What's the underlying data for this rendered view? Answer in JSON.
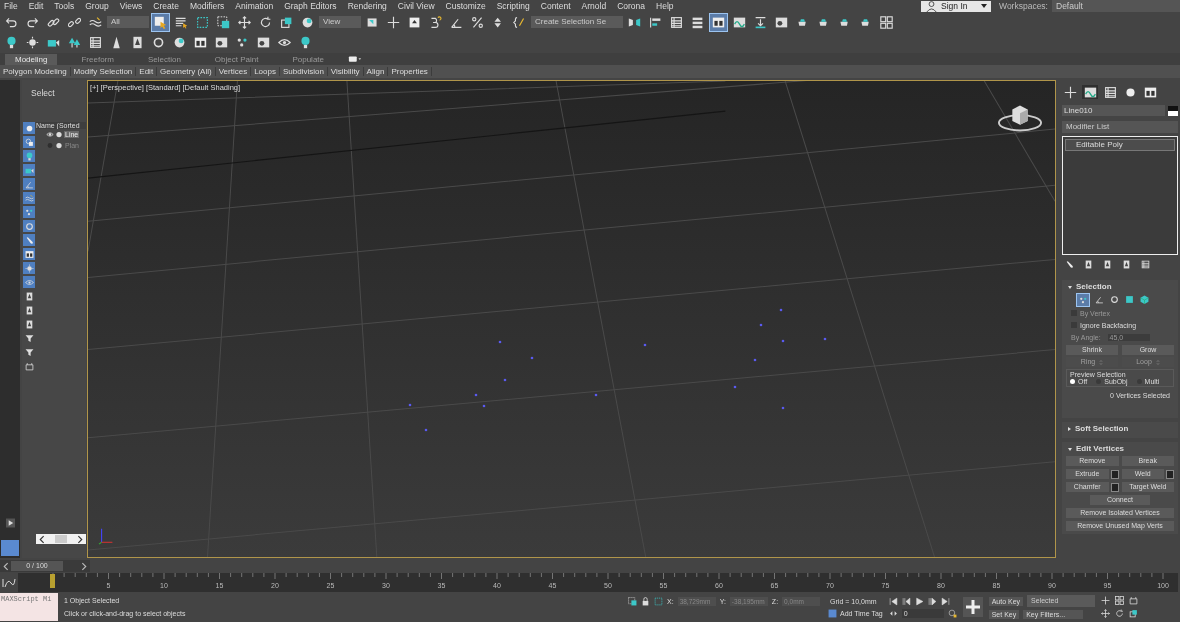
{
  "menu_bar": {
    "items": [
      "File",
      "Edit",
      "Tools",
      "Group",
      "Views",
      "Create",
      "Modifiers",
      "Animation",
      "Graph Editors",
      "Rendering",
      "Civil View",
      "Customize",
      "Scripting",
      "Content",
      "Arnold",
      "Corona",
      "Help"
    ],
    "sign_in": "Sign In",
    "workspaces_label": "Workspaces:",
    "workspace": "Default"
  },
  "main_toolbar": [
    {
      "kind": "tool",
      "selected": false
    },
    {
      "kind": "tool",
      "selected": false
    },
    {
      "kind": "tool",
      "selected": false
    },
    {
      "kind": "tool",
      "selected": false
    },
    {
      "kind": "tool",
      "selected": false
    },
    {
      "kind": "dropdown",
      "value": "All"
    },
    {
      "kind": "tool",
      "selected": true
    },
    {
      "kind": "tool",
      "selected": false
    },
    {
      "kind": "tool",
      "selected": false
    },
    {
      "kind": "tool",
      "selected": false
    },
    {
      "kind": "tool",
      "selected": false
    },
    {
      "kind": "tool",
      "selected": false
    },
    {
      "kind": "tool",
      "selected": false
    },
    {
      "kind": "tool",
      "selected": false
    },
    {
      "kind": "dropdown",
      "value": "View"
    },
    {
      "kind": "tool",
      "selected": false
    },
    {
      "kind": "tool",
      "selected": false
    },
    {
      "kind": "tool",
      "selected": false
    },
    {
      "kind": "tool",
      "selected": false
    },
    {
      "kind": "tool",
      "selected": false
    },
    {
      "kind": "tool",
      "selected": false
    },
    {
      "kind": "tool",
      "selected": false
    },
    {
      "kind": "tool",
      "selected": false
    },
    {
      "kind": "dropdown",
      "value": "Create Selection Se"
    },
    {
      "kind": "tool",
      "selected": false
    },
    {
      "kind": "tool",
      "selected": false
    },
    {
      "kind": "tool",
      "selected": false
    },
    {
      "kind": "tool",
      "selected": false
    },
    {
      "kind": "tool",
      "selected": true
    },
    {
      "kind": "tool",
      "selected": false
    },
    {
      "kind": "tool",
      "selected": false
    },
    {
      "kind": "tool",
      "selected": false
    },
    {
      "kind": "tool",
      "selected": false
    },
    {
      "kind": "tool",
      "selected": false
    },
    {
      "kind": "tool",
      "selected": false
    },
    {
      "kind": "tool",
      "selected": false
    },
    {
      "kind": "tool",
      "selected": false
    }
  ],
  "ribbon": {
    "tabs": [
      {
        "label": "Modeling",
        "selected": true
      },
      {
        "label": "Freeform",
        "selected": false
      },
      {
        "label": "Selection",
        "selected": false
      },
      {
        "label": "Object Paint",
        "selected": false
      },
      {
        "label": "Populate",
        "selected": false
      }
    ],
    "panels": [
      "Polygon Modeling",
      "Modify Selection",
      "Edit",
      "Geometry (All)",
      "Vertices",
      "Loops",
      "Subdivision",
      "Visibility",
      "Align",
      "Properties"
    ]
  },
  "scene_explorer": {
    "title": "Select",
    "column": "Name (Sorted",
    "filters": [
      {
        "on": true
      },
      {
        "on": true
      },
      {
        "on": true
      },
      {
        "on": true
      },
      {
        "on": true
      },
      {
        "on": true
      },
      {
        "on": true
      },
      {
        "on": true
      },
      {
        "on": true
      },
      {
        "on": true
      },
      {
        "on": true
      },
      {
        "on": true
      },
      {
        "on": false
      },
      {
        "on": false
      },
      {
        "on": false
      },
      {
        "on": false
      },
      {
        "on": false
      },
      {
        "on": false
      }
    ],
    "items": [
      {
        "name": "Line",
        "visible": true,
        "selected": true
      },
      {
        "name": "Plan",
        "visible": false,
        "selected": false
      }
    ]
  },
  "viewport": {
    "labels": [
      "[+]",
      "[Perspective]",
      "[Standard]",
      "[Default Shading]"
    ]
  },
  "command_panel": {
    "tabs": [
      {
        "selected": false
      },
      {
        "selected": true
      },
      {
        "selected": false
      },
      {
        "selected": false
      },
      {
        "selected": false
      }
    ],
    "object_name": "Line010",
    "modifier_list": "Modifier List",
    "stack": [
      {
        "name": "Editable Poly",
        "selected": true
      }
    ],
    "selection": {
      "title": "Selection",
      "expanded": true,
      "levels": [
        {
          "selected": true
        },
        {
          "selected": false
        },
        {
          "selected": false
        },
        {
          "selected": false
        },
        {
          "selected": false
        }
      ],
      "checks": [
        {
          "label": "By Vertex",
          "checked": false,
          "disabled": true
        },
        {
          "label": "Ignore Backfacing",
          "checked": false,
          "disabled": false
        }
      ],
      "by_angle": {
        "label": "By Angle:",
        "value": "45,0",
        "disabled": true
      },
      "buttons": [
        {
          "label": "Shrink",
          "disabled": false,
          "spinner": false
        },
        {
          "label": "Grow",
          "disabled": false,
          "spinner": false
        },
        {
          "label": "Ring",
          "disabled": true,
          "spinner": true
        },
        {
          "label": "Loop",
          "disabled": true,
          "spinner": true
        }
      ],
      "preview_title": "Preview Selection",
      "preview": [
        {
          "label": "Off",
          "selected": true
        },
        {
          "label": "SubObj",
          "selected": false
        },
        {
          "label": "Multi",
          "selected": false
        }
      ],
      "status": "0 Vertices Selected"
    },
    "soft_selection": {
      "title": "Soft Selection",
      "expanded": false
    },
    "edit_vertices": {
      "title": "Edit Vertices",
      "expanded": true,
      "buttons": [
        {
          "label": "Remove",
          "kind": "half",
          "settings": false
        },
        {
          "label": "Break",
          "kind": "half",
          "settings": false
        },
        {
          "label": "Extrude",
          "kind": "half",
          "settings": true
        },
        {
          "label": "Weld",
          "kind": "half",
          "settings": true
        },
        {
          "label": "Chamfer",
          "kind": "half",
          "settings": true
        },
        {
          "label": "Target Weld",
          "kind": "half",
          "settings": false
        },
        {
          "label": "Connect",
          "kind": "center",
          "settings": false
        },
        {
          "label": "Remove Isolated Vertices",
          "kind": "full",
          "settings": false
        },
        {
          "label": "Remove Unused Map Verts",
          "kind": "full",
          "settings": false
        }
      ]
    }
  },
  "time_slider": {
    "position": "0 / 100",
    "level": 0
  },
  "track_bar": {
    "labels": [
      "5",
      "10",
      "15",
      "20",
      "25",
      "30",
      "35",
      "40",
      "45",
      "50",
      "55",
      "60",
      "65",
      "70",
      "75",
      "80",
      "85",
      "90",
      "95",
      "100"
    ]
  },
  "status_bar": {
    "listener": "MAXScript Mi",
    "selection": "1 Object Selected",
    "prompt": "Click or click-and-drag to select objects",
    "x_label": "X:",
    "x": "38,729mm",
    "y_label": "Y:",
    "y": "-38,195mm",
    "z_label": "Z:",
    "z": "0,0mm",
    "grid": "Grid = 10,0mm",
    "time_tag": "Add Time Tag",
    "frame": "0",
    "auto_key": "Auto Key",
    "set_key": "Set Key",
    "key_mode": "Selected",
    "key_filters": "Key Filters..."
  }
}
